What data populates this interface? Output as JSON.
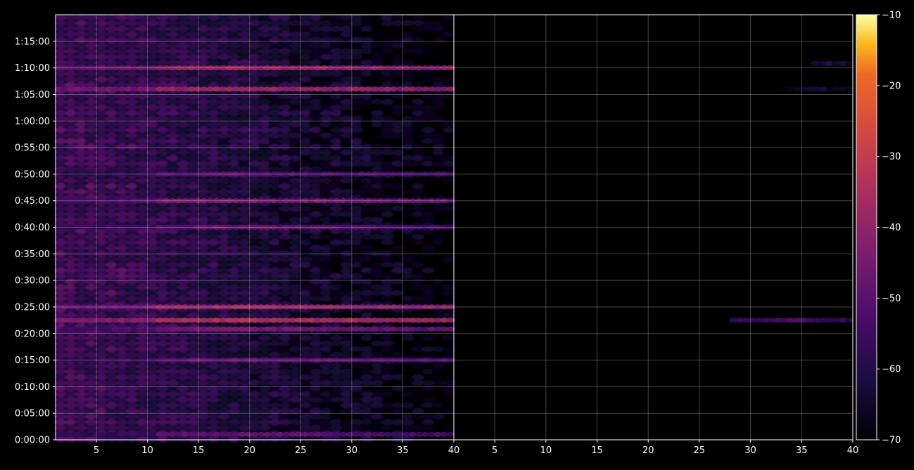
{
  "chart_data": {
    "type": "heatmap",
    "title": "",
    "xlabel": "",
    "ylabel": "",
    "colormap": "inferno",
    "background": "#000000",
    "grid": true,
    "panels": [
      {
        "name": "",
        "xlim": [
          1,
          40
        ],
        "x_ticks": [
          "5",
          "10",
          "15",
          "20",
          "25",
          "30",
          "35",
          "40"
        ]
      },
      {
        "name": "",
        "xlim": [
          1,
          40
        ],
        "x_ticks": [
          "5",
          "10",
          "15",
          "20",
          "25",
          "30",
          "35",
          "40"
        ]
      }
    ],
    "y_range_seconds": [
      0,
      4800
    ],
    "y_ticks": [
      {
        "label": "0:00:00",
        "s": 0
      },
      {
        "label": "0:05:00",
        "s": 300
      },
      {
        "label": "0:10:00",
        "s": 600
      },
      {
        "label": "0:15:00",
        "s": 900
      },
      {
        "label": "0:20:00",
        "s": 1200
      },
      {
        "label": "0:25:00",
        "s": 1500
      },
      {
        "label": "0:30:00",
        "s": 1800
      },
      {
        "label": "0:35:00",
        "s": 2100
      },
      {
        "label": "0:40:00",
        "s": 2400
      },
      {
        "label": "0:45:00",
        "s": 2700
      },
      {
        "label": "0:50:00",
        "s": 3000
      },
      {
        "label": "0:55:00",
        "s": 3300
      },
      {
        "label": "1:00:00",
        "s": 3600
      },
      {
        "label": "1:05:00",
        "s": 3900
      },
      {
        "label": "1:10:00",
        "s": 4200
      },
      {
        "label": "1:15:00",
        "s": 4500
      }
    ],
    "colorbar": {
      "min": -70,
      "max": -10,
      "ticks": [
        "−10",
        "−20",
        "−30",
        "−40",
        "−50",
        "−60",
        "−70"
      ]
    },
    "highlight_rows": [
      {
        "panel": 0,
        "s": 4200,
        "x_from": 1,
        "x_to": 40,
        "peak_db": -38
      },
      {
        "panel": 0,
        "s": 3960,
        "x_from": 1,
        "x_to": 40,
        "peak_db": -37
      },
      {
        "panel": 0,
        "s": 2700,
        "x_from": 1,
        "x_to": 40,
        "peak_db": -44
      },
      {
        "panel": 0,
        "s": 2400,
        "x_from": 1,
        "x_to": 40,
        "peak_db": -47
      },
      {
        "panel": 0,
        "s": 3000,
        "x_from": 1,
        "x_to": 40,
        "peak_db": -50
      },
      {
        "panel": 0,
        "s": 1500,
        "x_from": 1,
        "x_to": 40,
        "peak_db": -38
      },
      {
        "panel": 0,
        "s": 1350,
        "x_from": 1,
        "x_to": 40,
        "peak_db": -33
      },
      {
        "panel": 0,
        "s": 1250,
        "x_from": 1,
        "x_to": 40,
        "peak_db": -44
      },
      {
        "panel": 0,
        "s": 900,
        "x_from": 1,
        "x_to": 40,
        "peak_db": -48
      },
      {
        "panel": 0,
        "s": 60,
        "x_from": 1,
        "x_to": 40,
        "peak_db": -48
      },
      {
        "panel": 1,
        "s": 1350,
        "x_from": 28,
        "x_to": 40,
        "peak_db": -52
      },
      {
        "panel": 1,
        "s": 4250,
        "x_from": 36,
        "x_to": 40,
        "peak_db": -60
      },
      {
        "panel": 1,
        "s": 3960,
        "x_from": 33,
        "x_to": 40,
        "peak_db": -62
      }
    ]
  }
}
